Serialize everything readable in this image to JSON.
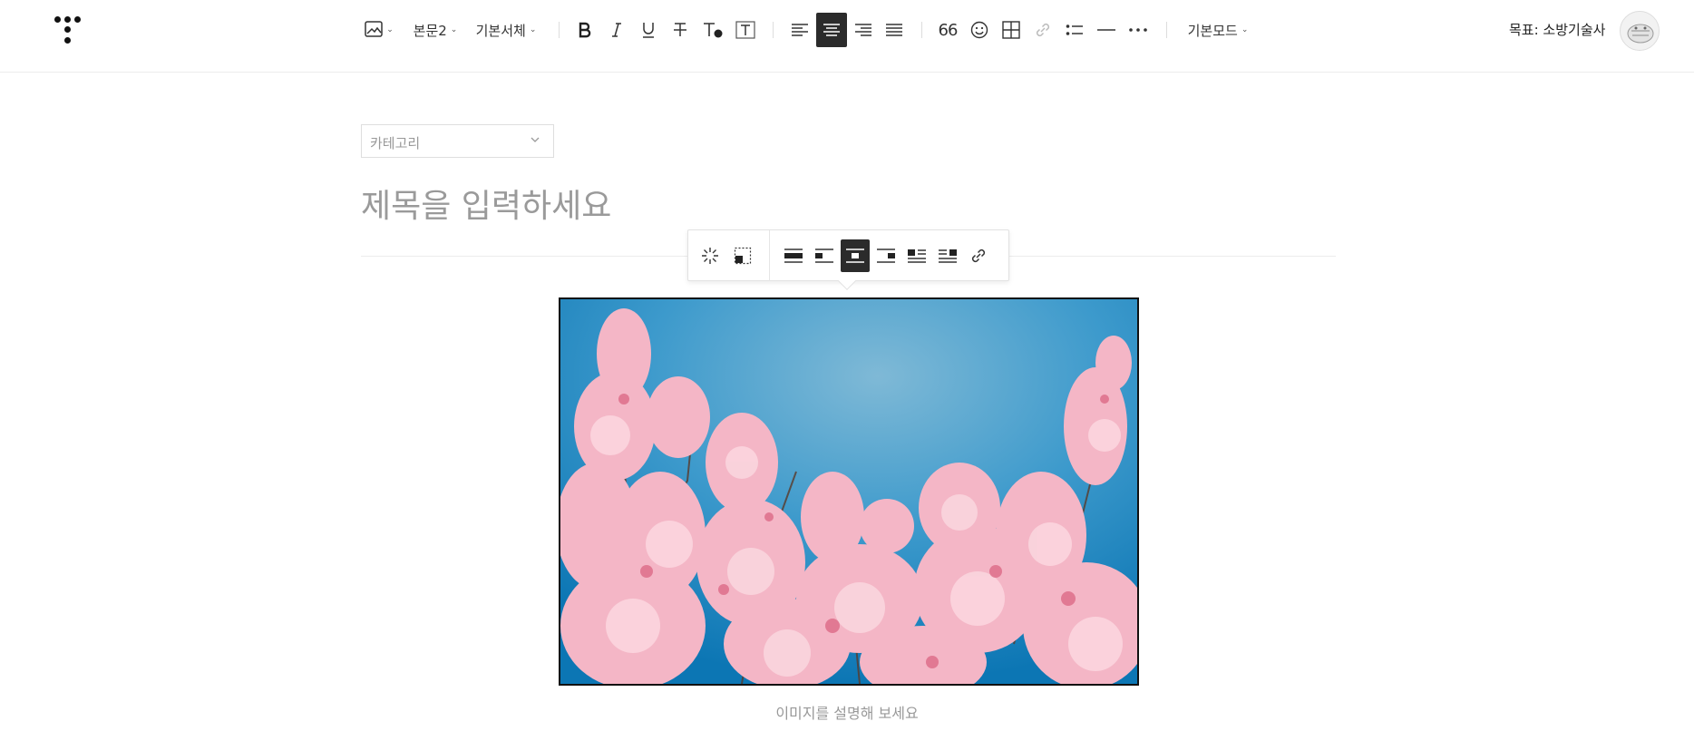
{
  "toolbar": {
    "image_menu": "image-icon",
    "paragraph_style": "본문2",
    "font_family": "기본서체",
    "quote_label": "66",
    "mode": "기본모드",
    "accent_active_bg": "#2b2b2b"
  },
  "header": {
    "goal_text": "목표: 소방기술사"
  },
  "editor": {
    "category_placeholder": "카테고리",
    "title_placeholder": "제목을 입력하세요",
    "caption_placeholder": "이미지를 설명해 보세요"
  },
  "image_toolbar": {
    "active_align": "center"
  },
  "image": {
    "subject": "cherry-blossom-photo"
  }
}
